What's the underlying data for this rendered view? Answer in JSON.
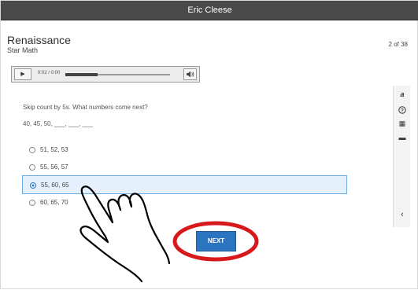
{
  "window": {
    "title": "Eric Cleese"
  },
  "brand": {
    "name": "Renaissance",
    "product": "Star Math"
  },
  "progress_label": "2 of 38",
  "audio": {
    "play_glyph": "▶",
    "time": "0:02 / 0:00",
    "played_fraction": 0.31
  },
  "question": {
    "prompt": "Skip count by 5s. What numbers come next?",
    "sequence": "40, 45, 50, ___, ___, ___"
  },
  "options": [
    {
      "label": "51, 52, 53",
      "selected": false
    },
    {
      "label": "55, 56, 57",
      "selected": false
    },
    {
      "label": "55, 60, 65",
      "selected": true
    },
    {
      "label": "60, 65, 70",
      "selected": false
    }
  ],
  "sidebar": {
    "tools": [
      {
        "icon": "text-size-icon",
        "glyph": "a"
      },
      {
        "icon": "help-icon",
        "glyph": "?"
      },
      {
        "icon": "calculator-icon",
        "glyph": "▦"
      },
      {
        "icon": "line-reader-icon",
        "glyph": "▬"
      }
    ],
    "collapse_glyph": "‹"
  },
  "next_button": {
    "label": "NEXT"
  },
  "colors": {
    "accent": "#2a74c0",
    "selected_bg": "#e4f0fc",
    "highlight_ring": "#d8191c",
    "titlebar": "#4a4a4a"
  }
}
